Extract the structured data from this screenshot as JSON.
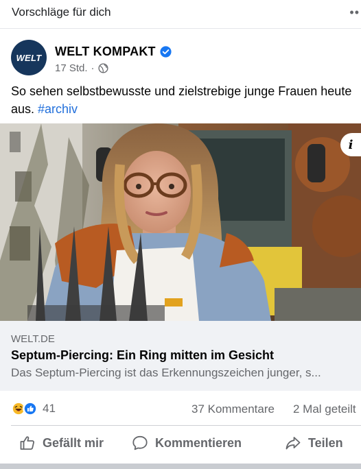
{
  "section": {
    "title": "Vorschläge für dich",
    "more": "••"
  },
  "post": {
    "avatar_text": "WELT",
    "page_name": "WELT KOMPAKT",
    "time": "17 Std.",
    "separator": "·",
    "text": "So sehen selbstbewusste und zielstrebige junge Frauen heute aus. ",
    "hashtag": "#archiv",
    "info_badge": "i"
  },
  "link": {
    "domain": "WELT.DE",
    "title": "Septum-Piercing: Ein Ring mitten im Gesicht",
    "description": "Das Septum-Piercing ist das Erkennungszeichen junger, s..."
  },
  "stats": {
    "reaction_count": "41",
    "comments": "37 Kommentare",
    "shares": "2 Mal geteilt"
  },
  "actions": {
    "like": "Gefällt mir",
    "comment": "Kommentieren",
    "share": "Teilen"
  },
  "colors": {
    "brand_blue": "#1877f2",
    "hashtag": "#216fdb",
    "avatar_bg": "#16365c"
  }
}
